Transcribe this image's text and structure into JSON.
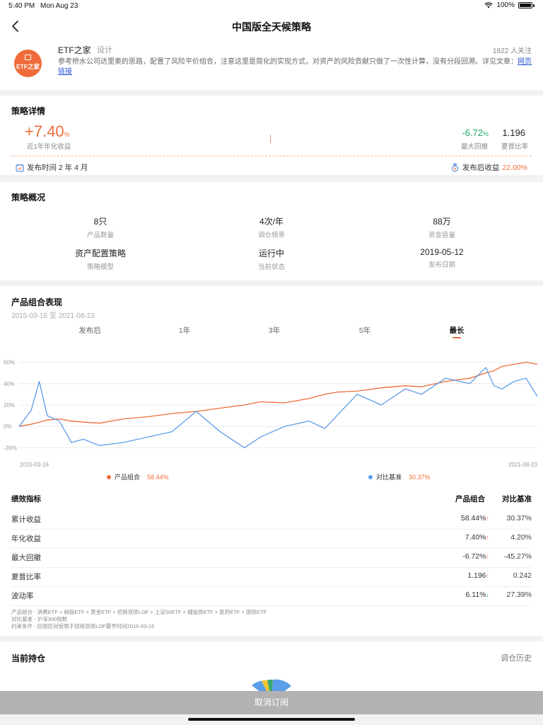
{
  "status": {
    "time": "5:40 PM",
    "date": "Mon Aug 23",
    "battery": "100%"
  },
  "nav": {
    "title": "中国版全天候策略"
  },
  "author": {
    "logo_text": "ETF之家",
    "name": "ETF之家",
    "tag": "设计",
    "followers": "1822 人关注",
    "desc": "参考桥水公司达里奥的思路，配置了风险平价组合，注意这里是简化的实现方式，对资产的风险贡献只做了一次性计算，没有分段回溯。详见文章：",
    "link": "网页链接"
  },
  "details": {
    "title": "策略详情",
    "annual_return": "+7.40",
    "annual_return_unit": "%",
    "annual_return_label": "近1年年化收益",
    "max_drawdown": "-6.72",
    "max_drawdown_unit": "%",
    "max_drawdown_label": "最大回撤",
    "sharpe": "1.196",
    "sharpe_label": "夏普比率",
    "publish_time": "发布时间 2 年 4 月",
    "publish_return_label": "发布后收益",
    "publish_return": "22.00%"
  },
  "overview": {
    "title": "策略概况",
    "items": [
      {
        "value": "8只",
        "label": "产品数量"
      },
      {
        "value": "4次/年",
        "label": "调仓频率"
      },
      {
        "value": "88万",
        "label": "资金容量"
      },
      {
        "value": "资产配置策略",
        "label": "策略模型"
      },
      {
        "value": "运行中",
        "label": "当前状态"
      },
      {
        "value": "2019-05-12",
        "label": "发布日期"
      }
    ]
  },
  "performance": {
    "title": "产品组合表现",
    "range": "2015-03-16 至 2021-08-23",
    "tabs": [
      "发布后",
      "1年",
      "3年",
      "5年",
      "最长"
    ],
    "active_tab": 4
  },
  "chart_data": {
    "type": "line",
    "x_start": "2015-03-16",
    "x_end": "2021-08-23",
    "x_tick_labels": [
      "2015-03-16",
      "2021-08-23"
    ],
    "y_ticks": [
      "60%",
      "40%",
      "20%",
      "0%",
      "-20%"
    ],
    "ylim": [
      -25,
      65
    ],
    "grid": true,
    "legend_position": "bottom",
    "x": [
      2015.2,
      2015.35,
      2015.45,
      2015.55,
      2015.7,
      2015.85,
      2016.0,
      2016.2,
      2016.5,
      2016.8,
      2017.1,
      2017.4,
      2017.7,
      2018.0,
      2018.2,
      2018.5,
      2018.8,
      2019.0,
      2019.15,
      2019.4,
      2019.7,
      2020.0,
      2020.2,
      2020.5,
      2020.8,
      2021.0,
      2021.1,
      2021.2,
      2021.35,
      2021.5,
      2021.64
    ],
    "series": [
      {
        "name": "产品组合",
        "color": "#ef6c3a",
        "total": "58.44%",
        "values": [
          0,
          2,
          4,
          6,
          7,
          5,
          4,
          3,
          7,
          9,
          12,
          14,
          17,
          20,
          23,
          22,
          26,
          30,
          32,
          33,
          36,
          38,
          37,
          42,
          45,
          50,
          52,
          56,
          58,
          60,
          58
        ]
      },
      {
        "name": "对比基准",
        "color": "#5b9de8",
        "total": "30.37%",
        "values": [
          0,
          15,
          42,
          10,
          5,
          -15,
          -12,
          -18,
          -15,
          -10,
          -5,
          14,
          -5,
          -20,
          -10,
          0,
          5,
          -2,
          10,
          30,
          20,
          35,
          30,
          45,
          40,
          55,
          38,
          35,
          42,
          45,
          28
        ]
      }
    ]
  },
  "metrics": {
    "header": "绩效指标",
    "col_product": "产品组合",
    "col_bench": "对比基准",
    "rows": [
      {
        "name": "累计收益",
        "product": "58.44%",
        "bench": "30.37%",
        "arrow": "↑",
        "dir": "up"
      },
      {
        "name": "年化收益",
        "product": "7.40%",
        "bench": "4.20%",
        "arrow": "↑",
        "dir": "up"
      },
      {
        "name": "最大回撤",
        "product": "-6.72%",
        "bench": "-45.27%",
        "arrow": "↑",
        "dir": "up"
      },
      {
        "name": "夏普比率",
        "product": "1.196",
        "bench": "0.242",
        "arrow": "↑",
        "dir": "up"
      },
      {
        "name": "波动率",
        "product": "6.11%",
        "bench": "27.39%",
        "arrow": "↓",
        "dir": "down"
      }
    ],
    "footnotes": [
      "产品组合 - 消费ETF + 纳指ETF + 黄金ETF + 招商双债LOF + 上证50ETF + 城投债ETF + 医药ETF + 国债ETF",
      "对比基准 - 沪深300指数",
      "约束条件 - 回测区间受限于招商双债LOF最早时间2015-03-16"
    ]
  },
  "holdings": {
    "title": "当前持仓",
    "history": "调仓历史"
  },
  "cancel": {
    "label": "取消订阅"
  }
}
